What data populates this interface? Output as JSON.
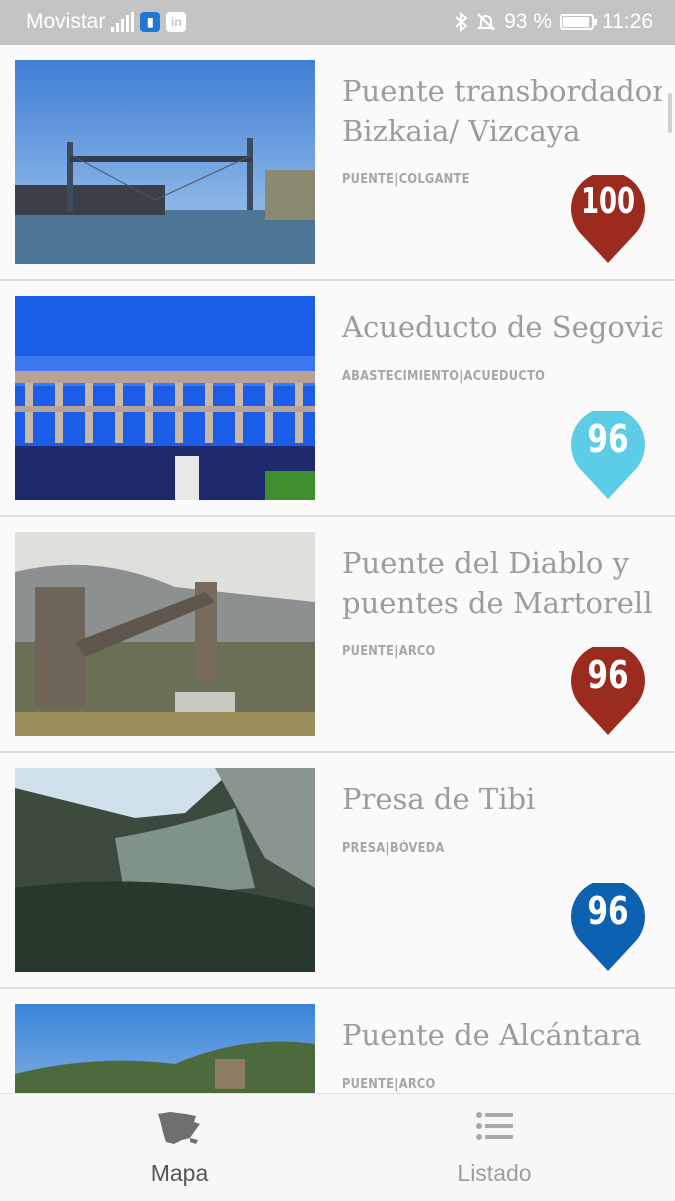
{
  "status_bar": {
    "carrier": "Movistar",
    "battery_percent": "93 %",
    "time": "11:26",
    "network_icon": "signal-bars-icon",
    "app_icons": [
      "shield-app-icon",
      "linkedin-icon"
    ],
    "system_icons": [
      "bluetooth-icon",
      "bell-muted-icon",
      "battery-icon"
    ]
  },
  "list": {
    "items": [
      {
        "title_line1": "Puente transbordador",
        "title_line2": "Bizkaia/ Vizcaya",
        "category": "PUENTE|COLGANTE",
        "score": "100",
        "pin_color": "#9c2b1f"
      },
      {
        "title_line1": "Acueducto de Segovia",
        "title_line2": "",
        "category": "ABASTECIMIENTO|ACUEDUCTO",
        "score": "96",
        "pin_color": "#5ccde6"
      },
      {
        "title_line1": "Puente del Diablo y",
        "title_line2": "puentes de Martorell",
        "category": "PUENTE|ARCO",
        "score": "96",
        "pin_color": "#9c2b1f"
      },
      {
        "title_line1": "Presa de Tibi",
        "title_line2": "",
        "category": "PRESA|BÓVEDA",
        "score": "96",
        "pin_color": "#0c62b0"
      },
      {
        "title_line1": "Puente de Alcántara",
        "title_line2": "",
        "category": "PUENTE|ARCO",
        "score": "",
        "pin_color": ""
      }
    ]
  },
  "bottom_nav": {
    "tabs": [
      {
        "label": "Mapa",
        "icon": "spain-map-icon",
        "active": true
      },
      {
        "label": "Listado",
        "icon": "list-icon",
        "active": false
      }
    ]
  }
}
